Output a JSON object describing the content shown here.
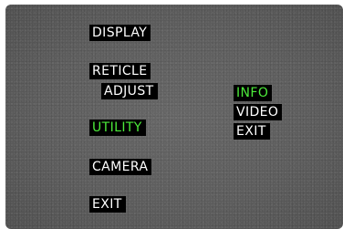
{
  "colors": {
    "highlight": "#4cea3a",
    "text": "#ffffff",
    "label_background": "#000000"
  },
  "main_menu": {
    "items": [
      {
        "label": "DISPLAY",
        "selected": false
      },
      {
        "label": "RETICLE",
        "selected": false
      },
      {
        "label": "ADJUST",
        "selected": false
      },
      {
        "label": "UTILITY",
        "selected": true
      },
      {
        "label": "CAMERA",
        "selected": false
      },
      {
        "label": "EXIT",
        "selected": false
      }
    ]
  },
  "submenu": {
    "items": [
      {
        "label": "INFO",
        "selected": true
      },
      {
        "label": "VIDEO",
        "selected": false
      },
      {
        "label": "EXIT",
        "selected": false
      }
    ]
  }
}
